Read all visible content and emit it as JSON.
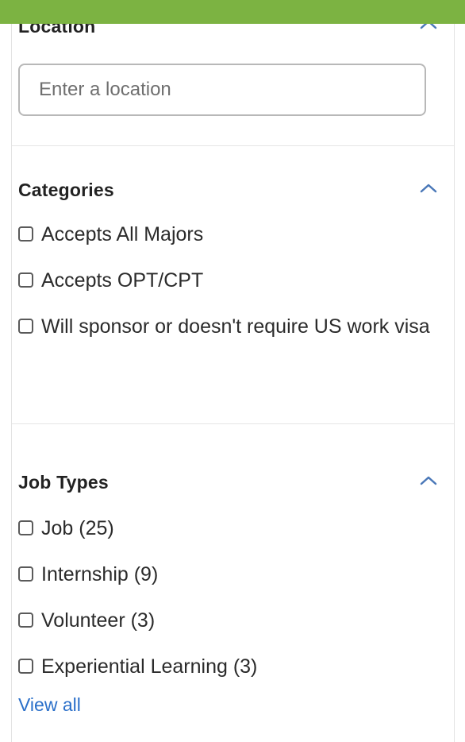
{
  "location": {
    "title": "Location",
    "input_placeholder": "Enter a location",
    "input_value": ""
  },
  "categories": {
    "title": "Categories",
    "options": [
      {
        "label": "Accepts All Majors",
        "checked": false
      },
      {
        "label": "Accepts OPT/CPT",
        "checked": false
      },
      {
        "label": "Will sponsor or doesn't require US work visa",
        "checked": false
      }
    ]
  },
  "job_types": {
    "title": "Job Types",
    "options": [
      {
        "label": "Job (25)",
        "checked": false
      },
      {
        "label": "Internship (9)",
        "checked": false
      },
      {
        "label": "Volunteer (3)",
        "checked": false
      },
      {
        "label": "Experiential Learning (3)",
        "checked": false
      }
    ],
    "view_all_label": "View all"
  },
  "colors": {
    "top_bar": "#7cb342",
    "link": "#2a6fc9",
    "chevron": "#4a78b8"
  },
  "icons": {
    "collapse": "chevron-up-icon",
    "checkbox": "checkbox-unchecked-icon"
  }
}
